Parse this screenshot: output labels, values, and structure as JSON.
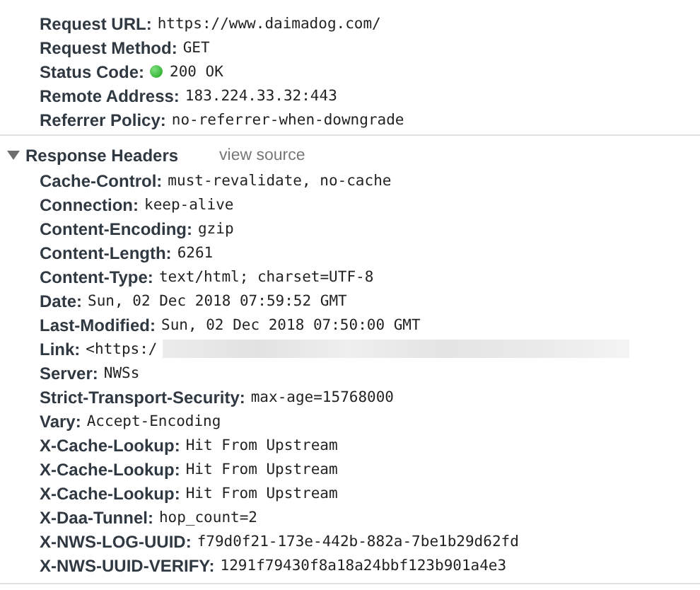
{
  "general": {
    "rows": [
      {
        "kind": "text",
        "name": "Request URL:",
        "value": "https://www.daimadog.com/"
      },
      {
        "kind": "text",
        "name": "Request Method:",
        "value": "GET"
      },
      {
        "kind": "status",
        "name": "Status Code:",
        "value": "200 OK"
      },
      {
        "kind": "text",
        "name": "Remote Address:",
        "value": "183.224.33.32:443"
      },
      {
        "kind": "text",
        "name": "Referrer Policy:",
        "value": "no-referrer-when-downgrade"
      }
    ]
  },
  "response_headers": {
    "title": "Response Headers",
    "expanded": true,
    "link": "view source",
    "rows": [
      {
        "kind": "text",
        "name": "Cache-Control:",
        "value": "must-revalidate, no-cache"
      },
      {
        "kind": "text",
        "name": "Connection:",
        "value": "keep-alive"
      },
      {
        "kind": "text",
        "name": "Content-Encoding:",
        "value": "gzip"
      },
      {
        "kind": "text",
        "name": "Content-Length:",
        "value": "6261"
      },
      {
        "kind": "text",
        "name": "Content-Type:",
        "value": "text/html; charset=UTF-8"
      },
      {
        "kind": "text",
        "name": "Date:",
        "value": "Sun, 02 Dec 2018 07:59:52 GMT"
      },
      {
        "kind": "text",
        "name": "Last-Modified:",
        "value": "Sun, 02 Dec 2018 07:50:00 GMT"
      },
      {
        "kind": "redacted",
        "name": "Link:",
        "value": "<https:/"
      },
      {
        "kind": "text",
        "name": "Server:",
        "value": "NWSs"
      },
      {
        "kind": "text",
        "name": "Strict-Transport-Security:",
        "value": "max-age=15768000"
      },
      {
        "kind": "text",
        "name": "Vary:",
        "value": "Accept-Encoding"
      },
      {
        "kind": "text",
        "name": "X-Cache-Lookup:",
        "value": "Hit From Upstream"
      },
      {
        "kind": "text",
        "name": "X-Cache-Lookup:",
        "value": "Hit From Upstream"
      },
      {
        "kind": "text",
        "name": "X-Cache-Lookup:",
        "value": "Hit From Upstream"
      },
      {
        "kind": "text",
        "name": "X-Daa-Tunnel:",
        "value": "hop_count=2"
      },
      {
        "kind": "text",
        "name": "X-NWS-LOG-UUID:",
        "value": "f79d0f21-173e-442b-882a-7be1b29d62fd"
      },
      {
        "kind": "text",
        "name": "X-NWS-UUID-VERIFY:",
        "value": "1291f79430f8a18a24bbf123b901a4e3"
      }
    ]
  }
}
